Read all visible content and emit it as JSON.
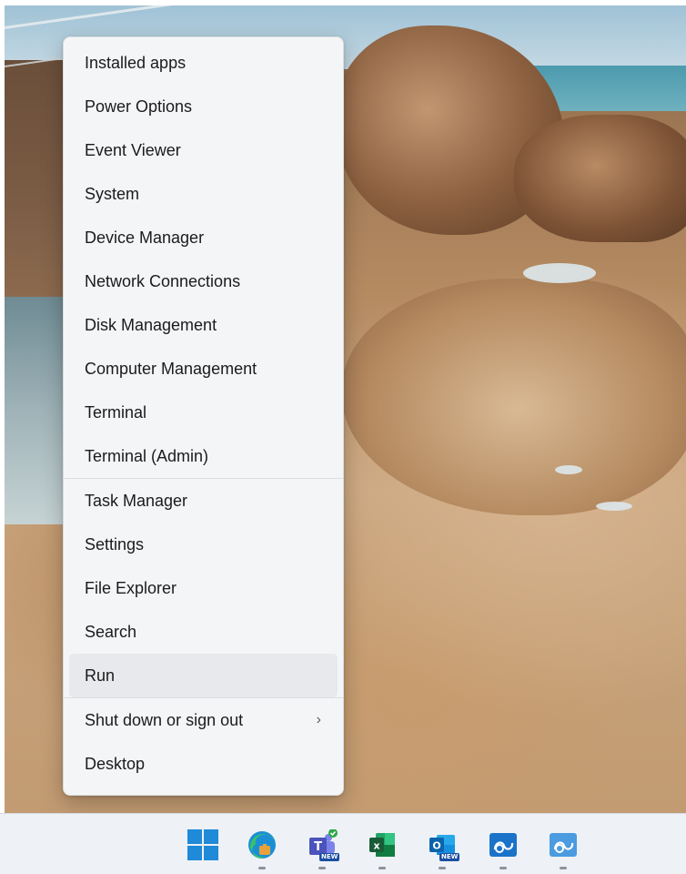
{
  "context_menu": {
    "items": [
      {
        "label": "Installed apps"
      },
      {
        "label": "Power Options"
      },
      {
        "label": "Event Viewer"
      },
      {
        "label": "System"
      },
      {
        "label": "Device Manager"
      },
      {
        "label": "Network Connections"
      },
      {
        "label": "Disk Management"
      },
      {
        "label": "Computer Management"
      },
      {
        "label": "Terminal"
      },
      {
        "label": "Terminal (Admin)"
      },
      {
        "label": "Task Manager"
      },
      {
        "label": "Settings"
      },
      {
        "label": "File Explorer"
      },
      {
        "label": "Search"
      },
      {
        "label": "Run"
      },
      {
        "label": "Shut down or sign out",
        "submenu_indicator": "›"
      },
      {
        "label": "Desktop"
      }
    ],
    "hovered_item": "Run"
  },
  "taskbar": {
    "icons": [
      {
        "name": "windows-start-icon"
      },
      {
        "name": "microsoft-edge-icon"
      },
      {
        "name": "microsoft-teams-icon",
        "badge": "NEW"
      },
      {
        "name": "microsoft-excel-icon"
      },
      {
        "name": "microsoft-outlook-icon",
        "badge": "NEW"
      },
      {
        "name": "remote-app-icon"
      },
      {
        "name": "remote-app-icon"
      }
    ]
  },
  "colors": {
    "accent": "#1f8ad8",
    "menu_background": "#f4f5f7",
    "taskbar_background": "#eef1f5"
  }
}
